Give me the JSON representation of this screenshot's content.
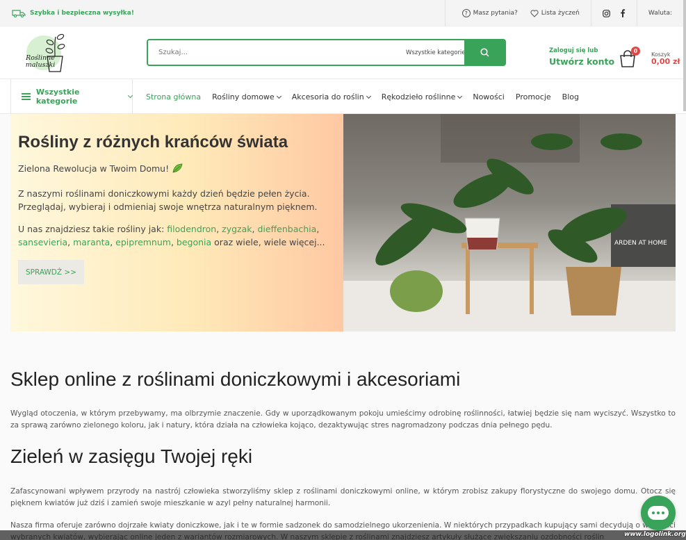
{
  "topbar": {
    "shipping": "Szybka i bezpieczna wysyłka!",
    "question": "Masz pytania?",
    "wishlist": "Lista życzeń",
    "currency": "Waluta:"
  },
  "header": {
    "logo_text_1": "Roślinne",
    "logo_text_2": "maluszki",
    "search_placeholder": "Szukaj...",
    "search_category": "Wszystkie kategorie",
    "login_line": "Zaloguj się lub",
    "create_account": "Utwórz konto",
    "cart_count": "0",
    "cart_label": "Koszyk",
    "cart_value": "0,00 zł"
  },
  "nav": {
    "all_categories": "Wszystkie kategorie",
    "items": [
      {
        "label": "Strona główna"
      },
      {
        "label": "Rośliny domowe"
      },
      {
        "label": "Akcesoria do roślin"
      },
      {
        "label": "Rękodzieło roślinne"
      },
      {
        "label": "Nowości"
      },
      {
        "label": "Promocje"
      },
      {
        "label": "Blog"
      }
    ]
  },
  "hero": {
    "title": "Rośliny z różnych krańców świata",
    "subtitle": "Zielona Rewolucja w Twoim Domu!",
    "text1": "Z naszymi roślinami doniczkowymi każdy dzień będzie pełen życia. Przeglądaj, wybieraj i odmieniaj swoje wnętrza naturalnym pięknem.",
    "text2_prefix": "U nas znajdziesz takie rośliny jak: ",
    "plants": [
      "filodendron",
      "zygzak",
      "dieffenbachia",
      "sansevieria",
      "maranta",
      "epipremnum",
      "begonia"
    ],
    "text2_suffix": " oraz wiele, wiele więcej...",
    "cta": "SPRAWDŹ >>",
    "image_text": "ARDEN AT HOME"
  },
  "content": {
    "h1": "Sklep online z roślinami doniczkowymi i akcesoriami",
    "p1": "Wygląd otoczenia, w którym przebywamy, ma olbrzymie znaczenie. Gdy w uporządkowanym pokoju umieścimy odrobinę roślinności, łatwiej będzie się nam wyciszyć. Wszystko to za sprawą zarówno zielonego koloru, jak i natury, która działa na człowieka kojąco, dezaktywując stres nagromadzony podczas dnia pełnego pędu.",
    "h2": "Zieleń w zasięgu Twojej ręki",
    "p2": "Zafascynowani wpływem przyrody na nastrój człowieka stworzyliśmy sklep z roślinami doniczkowymi online, w którym zrobisz zakupy florystyczne do swojego domu. Otocz się pięknem kwiatów już dziś i zamień swoje mieszkanie w azyl pełny naturalnej harmonii.",
    "p3": "Nasza firma oferuje zarówno dojrzałe kwiaty doniczkowe, jak i te w formie sadzonek do samodzielnego ukorzenienia. W niektórych przypadkach kupujący sami decydują o wielkości wybranych kwiatów, wybierając online jeden z wariantów rozmiarowych. W naszym sklepie z roślinami znajdziesz artykuły służące zwiększaniu ozdobności roślin"
  },
  "watermark": "www.logolink.org",
  "colors": {
    "accent": "#3aa35a",
    "sale": "#e04848"
  }
}
